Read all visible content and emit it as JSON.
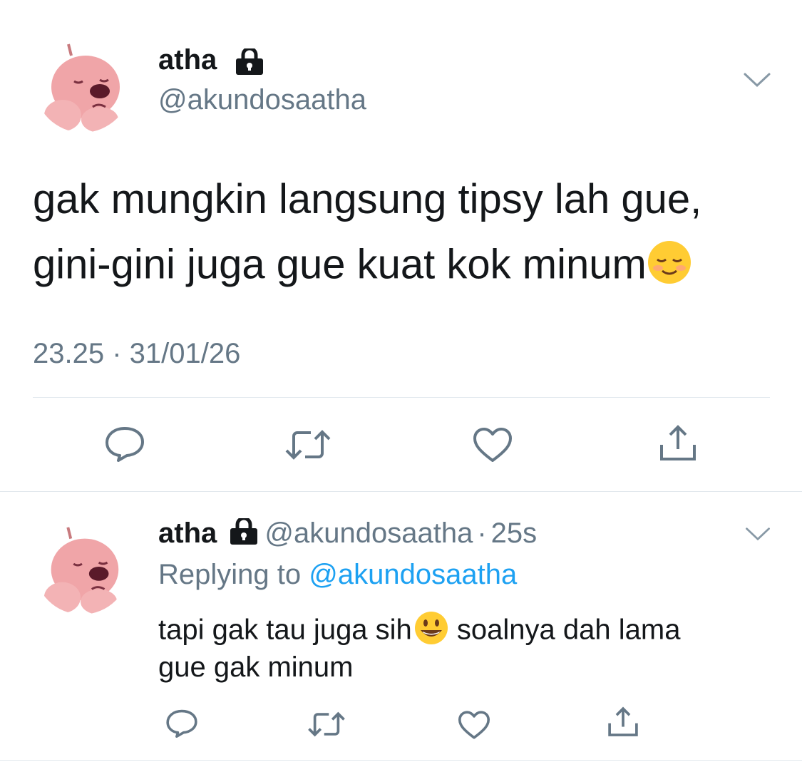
{
  "main_tweet": {
    "display_name": "atha",
    "handle": "@akundosaatha",
    "text_line1": "gak mungkin langsung tipsy lah gue,",
    "text_line2": "gini-gini juga gue kuat kok minum",
    "emoji": "relieved-smiling-face",
    "timestamp": "23.25 · 31/01/26"
  },
  "reply_tweet": {
    "display_name": "atha",
    "handle": "@akundosaatha",
    "time_sep": "·",
    "time_ago": "25s",
    "replying_prefix": "Replying to",
    "replying_handle": "@akundosaatha",
    "text_part1": "tapi gak tau juga sih",
    "text_part2": " soalnya dah lama",
    "text_line2": "gue gak minum",
    "emoji": "grinning-face"
  },
  "colors": {
    "text": "#14171a",
    "muted": "#657786",
    "link": "#1da1f2",
    "divider": "#e1e8ed"
  },
  "icons": [
    "lock-icon",
    "chevron-down-icon",
    "reply-icon",
    "retweet-icon",
    "like-icon",
    "share-icon"
  ]
}
